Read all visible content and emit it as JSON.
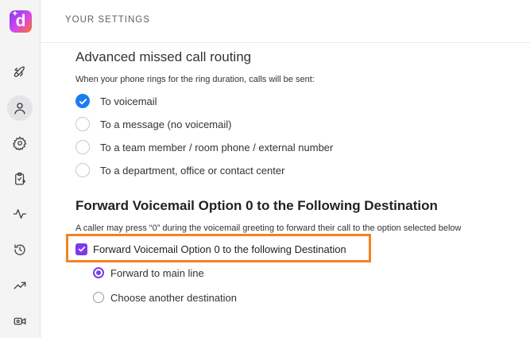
{
  "app": {
    "logo_letter": "d"
  },
  "header": {
    "title": "YOUR SETTINGS"
  },
  "missed_call": {
    "title": "Advanced missed call routing",
    "description": "When your phone rings for the ring duration, calls will be sent:",
    "options": [
      {
        "label": "To voicemail",
        "selected": true
      },
      {
        "label": "To a message (no voicemail)",
        "selected": false
      },
      {
        "label": "To a team member / room phone / external number",
        "selected": false
      },
      {
        "label": "To a department, office or contact center",
        "selected": false
      }
    ]
  },
  "forward": {
    "title": "Forward Voicemail Option 0 to the Following Destination",
    "description": "A caller may press “0” during the voicemail greeting to forward their call to the option selected below",
    "checkbox_label": "Forward Voicemail Option 0 to the following Destination",
    "checkbox_checked": true,
    "options": [
      {
        "label": "Forward to main line",
        "selected": true
      },
      {
        "label": "Choose another destination",
        "selected": false
      }
    ]
  },
  "colors": {
    "radio_selected": "#1a7cf2",
    "accent": "#7c3aed",
    "highlight": "#f58220"
  }
}
